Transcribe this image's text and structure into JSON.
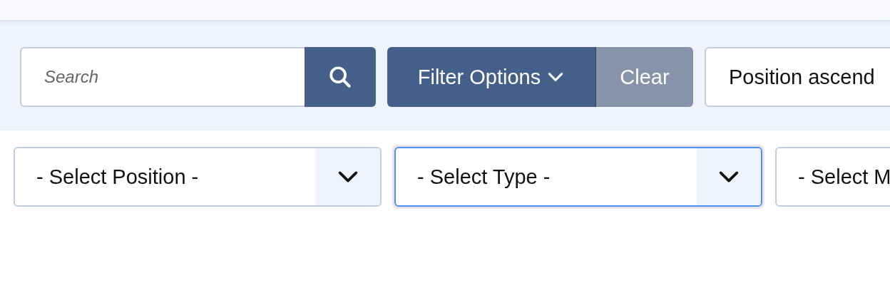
{
  "search": {
    "placeholder": "Search"
  },
  "filter_button": {
    "label": "Filter Options"
  },
  "clear_button": {
    "label": "Clear"
  },
  "sort_select": {
    "value": "Position ascend"
  },
  "filters": [
    {
      "value": "- Select Position -",
      "focused": false
    },
    {
      "value": "- Select Type -",
      "focused": true
    },
    {
      "value": "- Select M",
      "focused": false
    }
  ]
}
